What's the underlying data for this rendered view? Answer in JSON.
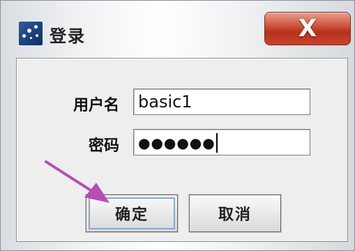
{
  "window": {
    "title": "登录",
    "close_label": "X"
  },
  "form": {
    "username_label": "用户名",
    "username_value": "basic1",
    "password_label": "密码",
    "password_value": "●●●●●●"
  },
  "buttons": {
    "ok_label": "确定",
    "cancel_label": "取消"
  },
  "colors": {
    "close_button": "#c6442e",
    "annotation_arrow": "#b44fb3",
    "app_icon": "#1a3f7a"
  }
}
